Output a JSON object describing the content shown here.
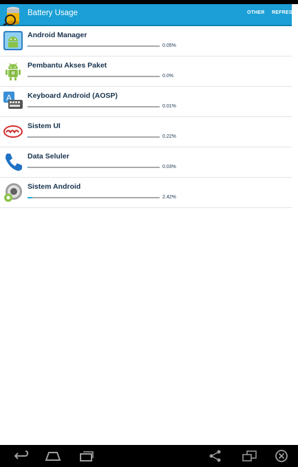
{
  "actionbar": {
    "title": "Battery Usage",
    "actions": [
      "OTHER",
      "REFRESH"
    ],
    "icon": "battery-app-icon",
    "color": "#1b9fd6"
  },
  "apps": [
    {
      "name": "Android Manager",
      "percent": "0.05%",
      "usage": 0.05,
      "icon": "android-manager-icon"
    },
    {
      "name": "Pembantu Akses Paket",
      "percent": "0.0%",
      "usage": 0.0,
      "icon": "android-robot-icon"
    },
    {
      "name": "Keyboard Android (AOSP)",
      "percent": "0.01%",
      "usage": 0.01,
      "icon": "keyboard-icon"
    },
    {
      "name": "Sistem UI",
      "percent": "0.22%",
      "usage": 0.22,
      "icon": "kitkat-icon"
    },
    {
      "name": "Data Seluler",
      "percent": "0.03%",
      "usage": 0.03,
      "icon": "phone-icon"
    },
    {
      "name": "Sistem Android",
      "percent": "2.42%",
      "usage": 2.42,
      "icon": "android-system-icon"
    }
  ],
  "navbar": {
    "icons": [
      "back-icon",
      "home-icon",
      "recents-icon",
      "share-icon",
      "screenshot-icon",
      "close-icon"
    ]
  }
}
